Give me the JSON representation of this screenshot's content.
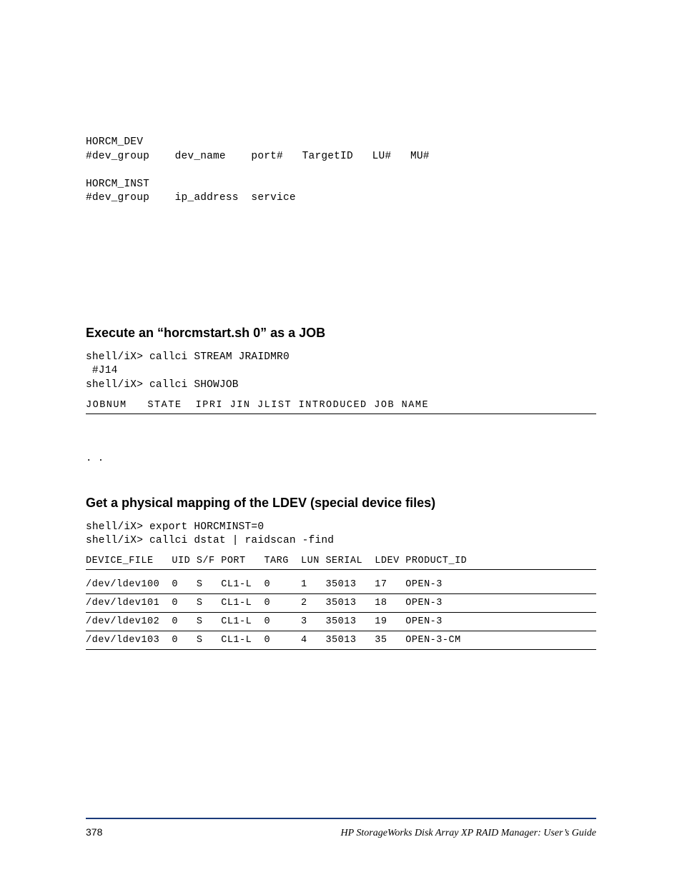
{
  "topblock": "HORCM_DEV\n#dev_group    dev_name    port#   TargetID   LU#   MU#\n\nHORCM_INST\n#dev_group    ip_address  service",
  "section1": {
    "heading": "Execute an “horcmstart.sh 0” as a JOB",
    "code": "shell/iX> callci STREAM JRAIDMR0\n #J14\nshell/iX> callci SHOWJOB",
    "table_header": "JOBNUM   STATE  IPRI JIN JLIST INTRODUCED JOB NAME"
  },
  "dots": ".\n.",
  "section2": {
    "heading": "Get a physical mapping of the LDEV (special device files)",
    "code": "shell/iX> export HORCMINST=0\nshell/iX> callci dstat | raidscan -find",
    "table_header": "DEVICE_FILE   UID S/F PORT   TARG  LUN SERIAL  LDEV PRODUCT_ID",
    "rows": [
      "/dev/ldev100  0   S   CL1-L  0     1   35013   17   OPEN-3",
      "/dev/ldev101  0   S   CL1-L  0     2   35013   18   OPEN-3",
      "/dev/ldev102  0   S   CL1-L  0     3   35013   19   OPEN-3",
      "/dev/ldev103  0   S   CL1-L  0     4   35013   35   OPEN-3-CM"
    ]
  },
  "footer": {
    "page": "378",
    "title": "HP StorageWorks Disk Array XP RAID Manager: User’s Guide"
  }
}
